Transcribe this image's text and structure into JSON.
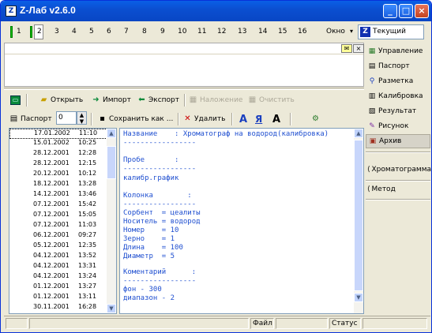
{
  "window": {
    "title": "Z-Лаб v2.6.0",
    "app_icon_letter": "Z"
  },
  "titlebar": {
    "minimize": "_",
    "maximize": "□",
    "close": "×"
  },
  "tabs": {
    "numbers": [
      "1",
      "2",
      "3",
      "4",
      "5",
      "6",
      "7",
      "8",
      "9",
      "10",
      "11",
      "12",
      "13",
      "14",
      "15",
      "16"
    ],
    "window_menu": "Окно",
    "window_arrow": "▾"
  },
  "mode": {
    "icon_letter": "Z",
    "value": "Текущий"
  },
  "toolbar1": {
    "open": "Открыть",
    "import": "Импорт",
    "export": "Экспорт",
    "overlay": "Наложение",
    "clear": "Очистить"
  },
  "toolbar2": {
    "passport": "Паспорт",
    "number": "0",
    "save_as": "Сохранить как ...",
    "delete": "Удалить",
    "font_a": "A",
    "font_ya": "Я",
    "font_a2": "A"
  },
  "list": {
    "items": [
      {
        "date": "17.01.2002",
        "time": "11:10",
        "selected": true
      },
      {
        "date": "15.01.2002",
        "time": "10:25"
      },
      {
        "date": "28.12.2001",
        "time": "12:28"
      },
      {
        "date": "28.12.2001",
        "time": "12:15"
      },
      {
        "date": "20.12.2001",
        "time": "10:12"
      },
      {
        "date": "18.12.2001",
        "time": "13:28"
      },
      {
        "date": "14.12.2001",
        "time": "13:46"
      },
      {
        "date": "07.12.2001",
        "time": "15:42"
      },
      {
        "date": "07.12.2001",
        "time": "15:05"
      },
      {
        "date": "07.12.2001",
        "time": "11:03"
      },
      {
        "date": "06.12.2001",
        "time": "09:27"
      },
      {
        "date": "05.12.2001",
        "time": "12:35"
      },
      {
        "date": "04.12.2001",
        "time": "13:52"
      },
      {
        "date": "04.12.2001",
        "time": "13:31"
      },
      {
        "date": "04.12.2001",
        "time": "13:24"
      },
      {
        "date": "01.12.2001",
        "time": "13:27"
      },
      {
        "date": "01.12.2001",
        "time": "13:11"
      },
      {
        "date": "30.11.2001",
        "time": "16:28"
      }
    ]
  },
  "text_panel": {
    "lines": [
      "Название    : Хроматограф на водород(калибровка)",
      "-----------------",
      "",
      "Пробе       :",
      "-----------------",
      "калибр.график",
      "",
      "Колонка        :",
      "-----------------",
      "Сорбент  = цеалиты",
      "Носитель = водород",
      "Номер    = 10",
      "Зерно    = 1",
      "Длина    = 100",
      "Диаметр  = 5",
      "",
      "Коментарий      :",
      "-----------------",
      "фон - 300",
      "диапазон - 2"
    ]
  },
  "sidebar": {
    "items": [
      {
        "label": "Управление",
        "icon": "▦"
      },
      {
        "label": "Паспорт",
        "icon": "▤"
      },
      {
        "label": "Разметка",
        "icon": "⚲"
      },
      {
        "label": "Калибровка",
        "icon": "▥"
      },
      {
        "label": "Результат",
        "icon": "▧"
      },
      {
        "label": "Рисунок",
        "icon": "✎"
      },
      {
        "label": "Архив",
        "icon": "▣"
      }
    ],
    "chromatogram": "Хроматограмма",
    "method": "Метод",
    "collapse_icon": "⟨"
  },
  "status": {
    "file": "Файл",
    "state": "Статус"
  }
}
